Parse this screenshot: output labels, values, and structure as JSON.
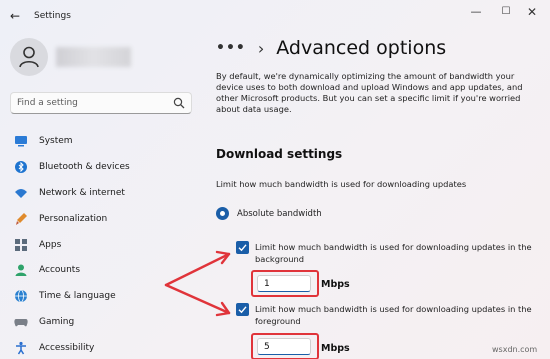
{
  "window": {
    "app_title": "Settings",
    "back_icon": "back-arrow-icon",
    "controls": [
      "minimize",
      "maximize",
      "close"
    ]
  },
  "sidebar": {
    "search_placeholder": "Find a setting",
    "items": [
      {
        "label": "System",
        "icon": "system-icon",
        "color": "#2b7bd6"
      },
      {
        "label": "Bluetooth & devices",
        "icon": "bluetooth-icon",
        "color": "#1e74d0"
      },
      {
        "label": "Network & internet",
        "icon": "wifi-icon",
        "color": "#2a78d0"
      },
      {
        "label": "Personalization",
        "icon": "brush-icon",
        "color": "#e08a2c"
      },
      {
        "label": "Apps",
        "icon": "apps-icon",
        "color": "#5b6b7c"
      },
      {
        "label": "Accounts",
        "icon": "accounts-icon",
        "color": "#2fa36b"
      },
      {
        "label": "Time & language",
        "icon": "globe-icon",
        "color": "#2a80d0"
      },
      {
        "label": "Gaming",
        "icon": "gaming-icon",
        "color": "#7a7f88"
      },
      {
        "label": "Accessibility",
        "icon": "accessibility-icon",
        "color": "#2a6fcf"
      }
    ]
  },
  "main": {
    "breadcrumb_more": "•••",
    "title": "Advanced options",
    "description": "By default, we're dynamically optimizing the amount of bandwidth your device uses to both download and upload Windows and app updates, and other Microsoft products. But you can set a specific limit if you're worried about data usage.",
    "section_title": "Download settings",
    "limit_text": "Limit how much bandwidth is used for downloading updates",
    "radio_label": "Absolute bandwidth",
    "radio_selected": true,
    "checkbox1_label": "Limit how much bandwidth is used for downloading updates in the background",
    "checkbox1_checked": true,
    "background_value": "1",
    "background_unit": "Mbps",
    "checkbox2_label": "Limit how much bandwidth is used for downloading updates in the foreground",
    "checkbox2_checked": true,
    "foreground_value": "5",
    "foreground_unit": "Mbps"
  },
  "annotation_color": "#e0343a",
  "watermark": "wsxdn.com"
}
